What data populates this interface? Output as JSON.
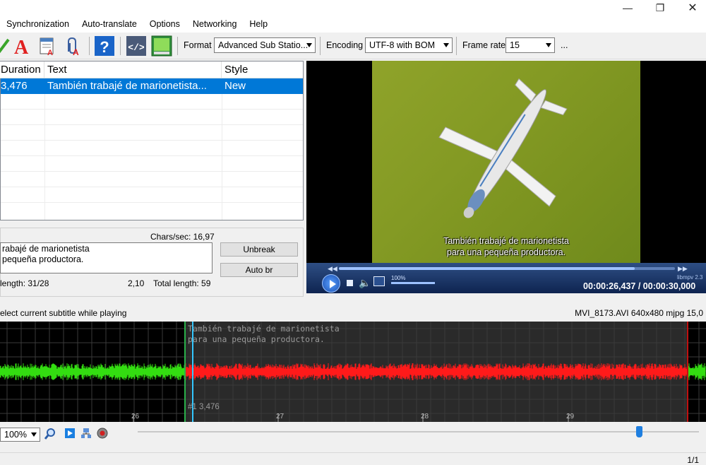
{
  "menu": [
    "Synchronization",
    "Auto-translate",
    "Options",
    "Networking",
    "Help"
  ],
  "toolbar": {
    "format_label": "Format",
    "format_value": "Advanced Sub Statio...",
    "encoding_label": "Encoding",
    "encoding_value": "UTF-8 with BOM",
    "framerate_label": "Frame rate",
    "framerate_value": "15",
    "more": "..."
  },
  "grid": {
    "headers": {
      "duration": "Duration",
      "text": "Text",
      "style": "Style"
    },
    "rows": [
      {
        "duration": "3,476",
        "text": "También trabajé de marionetista...",
        "style": "New",
        "selected": true
      }
    ]
  },
  "editor": {
    "chars_sec": "Chars/sec: 16,97",
    "text": "rabajé de marionetista\npequeña productora.",
    "line_length": "length: 31/28",
    "ratio": "2,10",
    "total_length": "Total length: 59",
    "unbreak": "Unbreak",
    "autobr": "Auto br"
  },
  "video": {
    "subtitle_line1": "También trabajé de marionetista",
    "subtitle_line2": "para una pequeña productora.",
    "engine": "libmpv 2.3",
    "volume": "100%",
    "timecode": "00:00:26,437 / 00:00:30,000"
  },
  "status": {
    "left": "elect current subtitle while playing",
    "right": "MVI_8173.AVI 640x480 mjpg 15,0"
  },
  "waveform": {
    "sub_line1": "También trabajé de marionetista",
    "sub_line2": "para una pequeña productora.",
    "marker": "#1  3,476",
    "ticks": [
      "26",
      "27",
      "28",
      "29"
    ]
  },
  "bottom": {
    "zoom": "100%"
  },
  "statusbar": {
    "pages": "1/1"
  },
  "colors": {
    "selection": "#0078d7",
    "waveform_active": "#ff1a1a",
    "waveform_inactive": "#33dd11"
  }
}
